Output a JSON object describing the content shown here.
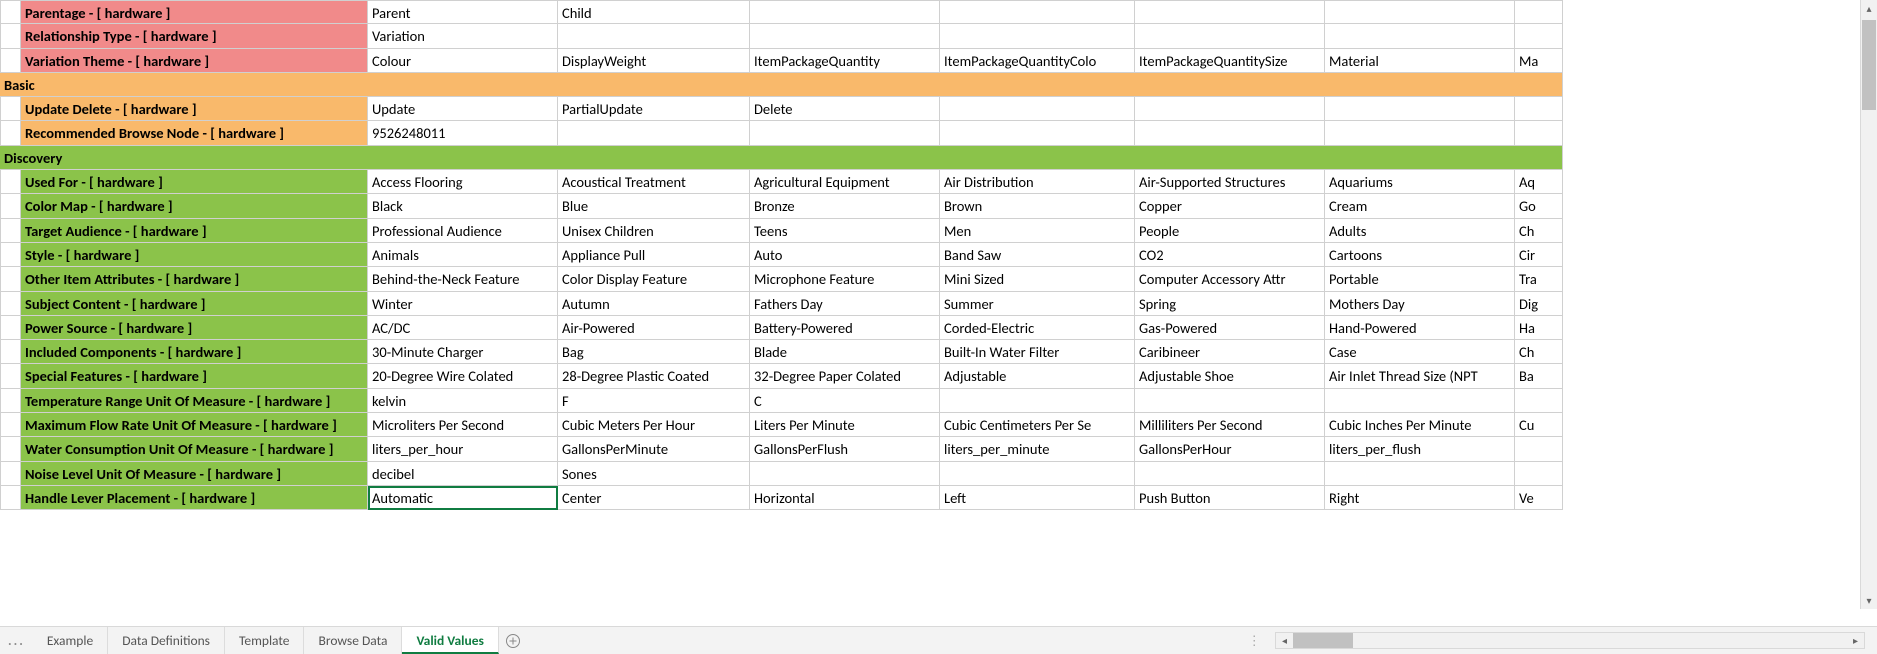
{
  "rows": [
    {
      "type": "data",
      "hdrClass": "hdr-red",
      "label": "Parentage - [ hardware ]",
      "values": [
        "Parent",
        "Child",
        "",
        "",
        "",
        "",
        ""
      ]
    },
    {
      "type": "data",
      "hdrClass": "hdr-red",
      "label": "Relationship Type - [ hardware ]",
      "values": [
        "Variation",
        "",
        "",
        "",
        "",
        "",
        ""
      ]
    },
    {
      "type": "data",
      "hdrClass": "hdr-red",
      "label": "Variation Theme - [ hardware ]",
      "values": [
        "Colour",
        "DisplayWeight",
        "ItemPackageQuantity",
        "ItemPackageQuantityColo",
        "ItemPackageQuantitySize",
        "Material",
        "Ma"
      ]
    },
    {
      "type": "section",
      "secClass": "sec-orange",
      "label": "Basic"
    },
    {
      "type": "data",
      "hdrClass": "hdr-orange",
      "label": "Update Delete - [ hardware ]",
      "values": [
        "Update",
        "PartialUpdate",
        "Delete",
        "",
        "",
        "",
        ""
      ]
    },
    {
      "type": "data",
      "hdrClass": "hdr-orange",
      "label": "Recommended Browse Node - [ hardware ]",
      "values": [
        "9526248011",
        "",
        "",
        "",
        "",
        "",
        ""
      ]
    },
    {
      "type": "section",
      "secClass": "sec-green",
      "label": "Discovery"
    },
    {
      "type": "data",
      "hdrClass": "hdr-green",
      "label": "Used For - [ hardware ]",
      "values": [
        "Access Flooring",
        "Acoustical Treatment",
        "Agricultural Equipment",
        "Air Distribution",
        "Air-Supported Structures",
        "Aquariums",
        "Aq"
      ]
    },
    {
      "type": "data",
      "hdrClass": "hdr-green",
      "label": "Color Map - [ hardware ]",
      "values": [
        "Black",
        "Blue",
        "Bronze",
        "Brown",
        "Copper",
        "Cream",
        "Go"
      ]
    },
    {
      "type": "data",
      "hdrClass": "hdr-green",
      "label": "Target Audience - [ hardware ]",
      "values": [
        "Professional Audience",
        "Unisex Children",
        "Teens",
        "Men",
        "People",
        "Adults",
        "Ch"
      ]
    },
    {
      "type": "data",
      "hdrClass": "hdr-green",
      "label": "Style - [ hardware ]",
      "values": [
        "Animals",
        "Appliance Pull",
        "Auto",
        "Band Saw",
        "CO2",
        "Cartoons",
        "Cir"
      ]
    },
    {
      "type": "data",
      "hdrClass": "hdr-green",
      "label": "Other Item Attributes - [ hardware ]",
      "values": [
        "Behind-the-Neck Feature",
        "Color Display Feature",
        "Microphone Feature",
        "Mini Sized",
        "Computer Accessory Attr",
        "Portable",
        "Tra"
      ]
    },
    {
      "type": "data",
      "hdrClass": "hdr-green",
      "label": "Subject Content - [ hardware ]",
      "values": [
        "Winter",
        "Autumn",
        "Fathers Day",
        "Summer",
        "Spring",
        "Mothers Day",
        "Dig"
      ]
    },
    {
      "type": "data",
      "hdrClass": "hdr-green",
      "label": "Power Source - [ hardware ]",
      "values": [
        "AC/DC",
        "Air-Powered",
        "Battery-Powered",
        "Corded-Electric",
        "Gas-Powered",
        "Hand-Powered",
        "Ha"
      ]
    },
    {
      "type": "data",
      "hdrClass": "hdr-green",
      "label": "Included Components - [ hardware ]",
      "values": [
        "30-Minute Charger",
        "Bag",
        "Blade",
        "Built-In Water Filter",
        "Caribineer",
        "Case",
        "Ch"
      ]
    },
    {
      "type": "data",
      "hdrClass": "hdr-green",
      "label": "Special Features - [ hardware ]",
      "values": [
        "20-Degree Wire Colated",
        "28-Degree Plastic Coated",
        "32-Degree Paper Colated",
        "Adjustable",
        "Adjustable Shoe",
        "Air Inlet Thread Size (NPT",
        "Ba"
      ]
    },
    {
      "type": "data",
      "hdrClass": "hdr-green",
      "label": "Temperature Range Unit Of Measure - [ hardware ]",
      "values": [
        "kelvin",
        "F",
        "C",
        "",
        "",
        "",
        ""
      ]
    },
    {
      "type": "data",
      "hdrClass": "hdr-green",
      "label": "Maximum Flow Rate Unit Of Measure - [ hardware ]",
      "values": [
        "Microliters Per Second",
        "Cubic Meters Per Hour",
        "Liters Per Minute",
        "Cubic Centimeters Per Se",
        "Milliliters Per Second",
        "Cubic Inches Per Minute",
        "Cu"
      ]
    },
    {
      "type": "data",
      "hdrClass": "hdr-green",
      "label": "Water Consumption Unit Of Measure - [ hardware ]",
      "values": [
        "liters_per_hour",
        "GallonsPerMinute",
        "GallonsPerFlush",
        "liters_per_minute",
        "GallonsPerHour",
        "liters_per_flush",
        ""
      ]
    },
    {
      "type": "data",
      "hdrClass": "hdr-green",
      "label": "Noise Level Unit Of Measure - [ hardware ]",
      "values": [
        "decibel",
        "Sones",
        "",
        "",
        "",
        "",
        ""
      ]
    },
    {
      "type": "data",
      "hdrClass": "hdr-green",
      "label": "Handle Lever Placement - [ hardware ]",
      "values": [
        "Automatic",
        "Center",
        "Horizontal",
        "Left",
        "Push Button",
        "Right",
        "Ve"
      ],
      "selectCol": 0
    }
  ],
  "tabs": {
    "more": "...",
    "items": [
      "Example",
      "Data Definitions",
      "Template",
      "Browse Data",
      "Valid Values"
    ],
    "active": 4
  }
}
